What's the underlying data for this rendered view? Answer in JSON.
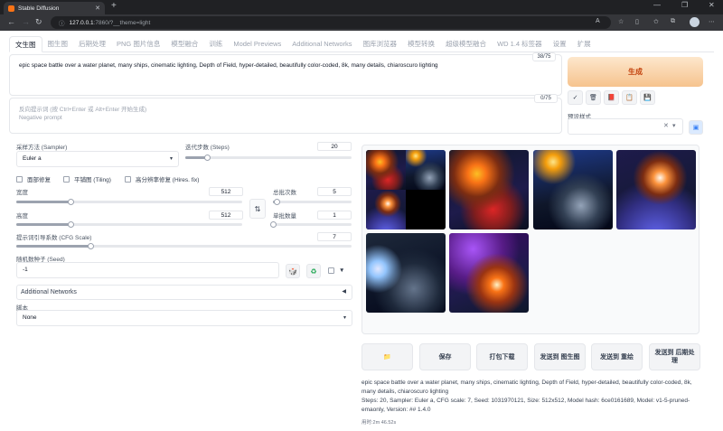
{
  "browser": {
    "tab_title": "Stable Diffusion",
    "new_tab": "+",
    "url_host": "127.0.0.1",
    "url_rest": ":7860/?__theme=light",
    "window_controls": [
      "—",
      "❐",
      "✕"
    ]
  },
  "app_tabs": [
    "文生图",
    "图生图",
    "后期处理",
    "PNG 图片信息",
    "模型融合",
    "训练",
    "Model Previews",
    "Additional Networks",
    "图库浏览器",
    "模型转换",
    "超级模型融合",
    "WD 1.4 标签器",
    "设置",
    "扩展"
  ],
  "prompt": {
    "text": "epic space battle over a water planet, many ships, cinematic lighting, Depth of Field,  hyper-detailed, beautifully color-coded, 8k, many details, chiaroscuro lighting",
    "counter": "38/75"
  },
  "negative_prompt": {
    "placeholder_line1": "反向提示词 (按 Ctrl+Enter 或 Alt+Enter 开始生成)",
    "placeholder_line2": "Negative prompt",
    "counter": "0/75"
  },
  "generate_label": "生成",
  "tool_icons": [
    "✓",
    "🗑",
    "📕",
    "📋",
    "💾"
  ],
  "styles": {
    "label": "预设样式",
    "clear": "✕",
    "caret": "▾",
    "apply_icon": "▣"
  },
  "sampler": {
    "label": "采样方法 (Sampler)",
    "value": "Euler a"
  },
  "steps": {
    "label": "迭代步数 (Steps)",
    "value": "20",
    "fraction": 0.13
  },
  "checkboxes": [
    "面部修复",
    "平铺图 (Tiling)",
    "高分辨率修复 (Hires. fix)"
  ],
  "width": {
    "label": "宽度",
    "value": "512",
    "fraction": 0.24
  },
  "height": {
    "label": "高度",
    "value": "512",
    "fraction": 0.24
  },
  "swap_icon": "⇅",
  "batch_count": {
    "label": "总批次数",
    "value": "5",
    "fraction": 0.05
  },
  "batch_size": {
    "label": "单批数量",
    "value": "1",
    "fraction": 0.0
  },
  "cfg": {
    "label": "提示词引导系数 (CFG Scale)",
    "value": "7",
    "fraction": 0.22
  },
  "seed": {
    "label": "随机数种子 (Seed)",
    "value": "-1",
    "dice": "🎲",
    "recycle": "♻",
    "extra_caret": "▼"
  },
  "additional_networks": {
    "label": "Additional Networks",
    "arrow": "◀"
  },
  "script": {
    "label": "脚本",
    "value": "None"
  },
  "actions": [
    {
      "label": "📁"
    },
    {
      "label": "保存"
    },
    {
      "label": "打包下载"
    },
    {
      "label": "发送到 图生图"
    },
    {
      "label": "发送到 重绘"
    },
    {
      "label": "发送到 后期处理"
    }
  ],
  "info": {
    "prompt": "epic space battle over a water planet, many ships, cinematic lighting, Depth of Field, hyper-detailed, beautifully color-coded, 8k, many details, chiaroscuro lighting",
    "params": "Steps: 20, Sampler: Euler a, CFG scale: 7, Seed: 1031970121, Size: 512x512, Model hash: 6ce0161689, Model: v1-5-pruned-emaonly, Version: ## 1.4.0",
    "elapsed": "用时:2m 46.52s"
  }
}
